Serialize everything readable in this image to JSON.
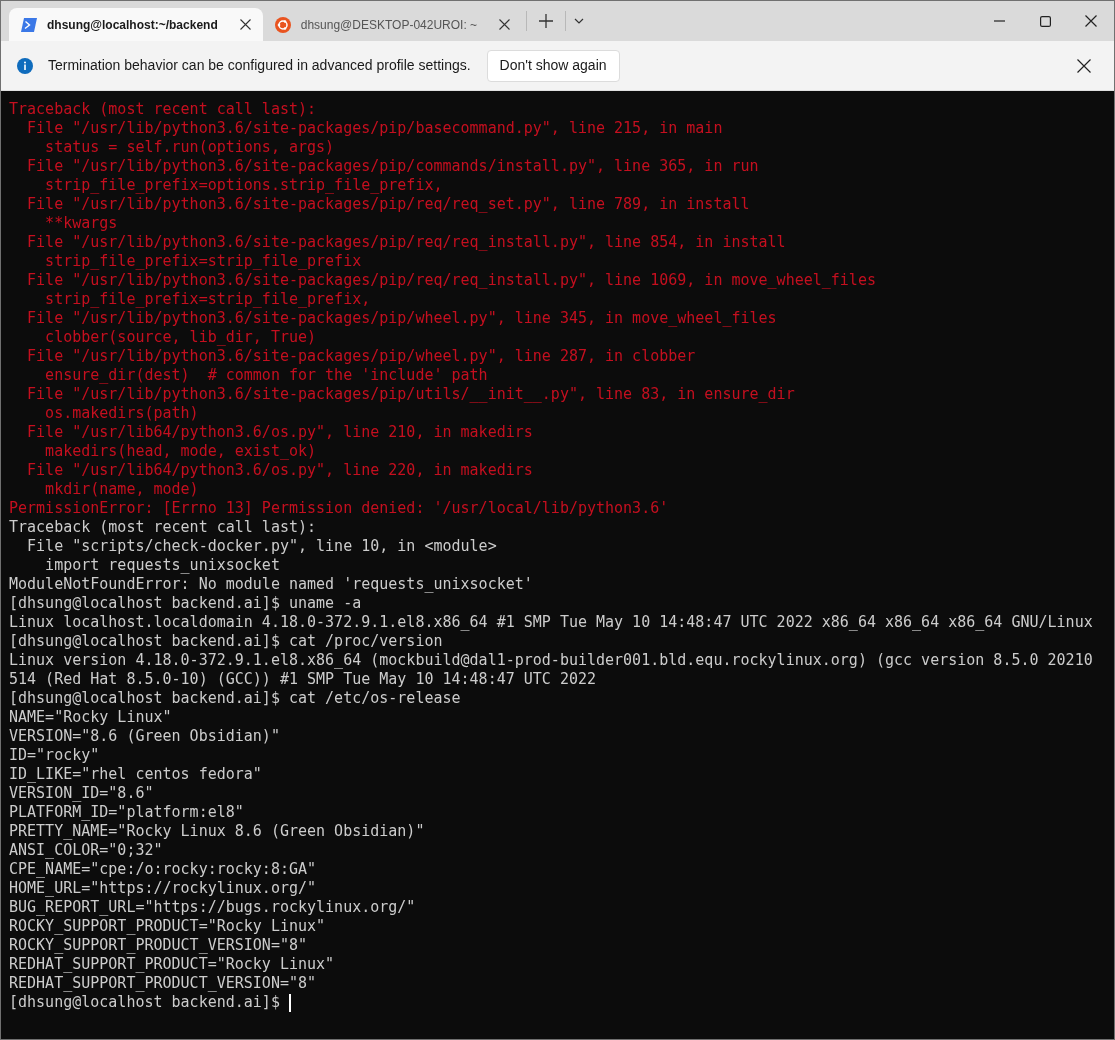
{
  "tabs": [
    {
      "title": "dhsung@localhost:~/backend",
      "kind": "shell",
      "selected": true
    },
    {
      "title": "dhsung@DESKTOP-042UROI: ~",
      "kind": "ubuntu",
      "selected": false
    }
  ],
  "infobar": {
    "message": "Termination behavior can be configured in advanced profile settings.",
    "button": "Don't show again"
  },
  "terminal": {
    "lines": [
      {
        "kind": "error",
        "text": "Traceback (most recent call last):"
      },
      {
        "kind": "error",
        "text": "  File \"/usr/lib/python3.6/site-packages/pip/basecommand.py\", line 215, in main"
      },
      {
        "kind": "error",
        "text": "    status = self.run(options, args)"
      },
      {
        "kind": "error",
        "text": "  File \"/usr/lib/python3.6/site-packages/pip/commands/install.py\", line 365, in run"
      },
      {
        "kind": "error",
        "text": "    strip_file_prefix=options.strip_file_prefix,"
      },
      {
        "kind": "error",
        "text": "  File \"/usr/lib/python3.6/site-packages/pip/req/req_set.py\", line 789, in install"
      },
      {
        "kind": "error",
        "text": "    **kwargs"
      },
      {
        "kind": "error",
        "text": "  File \"/usr/lib/python3.6/site-packages/pip/req/req_install.py\", line 854, in install"
      },
      {
        "kind": "error",
        "text": "    strip_file_prefix=strip_file_prefix"
      },
      {
        "kind": "error",
        "text": "  File \"/usr/lib/python3.6/site-packages/pip/req/req_install.py\", line 1069, in move_wheel_files"
      },
      {
        "kind": "error",
        "text": "    strip_file_prefix=strip_file_prefix,"
      },
      {
        "kind": "error",
        "text": "  File \"/usr/lib/python3.6/site-packages/pip/wheel.py\", line 345, in move_wheel_files"
      },
      {
        "kind": "error",
        "text": "    clobber(source, lib_dir, True)"
      },
      {
        "kind": "error",
        "text": "  File \"/usr/lib/python3.6/site-packages/pip/wheel.py\", line 287, in clobber"
      },
      {
        "kind": "error",
        "text": "    ensure_dir(dest)  # common for the 'include' path"
      },
      {
        "kind": "error",
        "text": "  File \"/usr/lib/python3.6/site-packages/pip/utils/__init__.py\", line 83, in ensure_dir"
      },
      {
        "kind": "error",
        "text": "    os.makedirs(path)"
      },
      {
        "kind": "error",
        "text": "  File \"/usr/lib64/python3.6/os.py\", line 210, in makedirs"
      },
      {
        "kind": "error",
        "text": "    makedirs(head, mode, exist_ok)"
      },
      {
        "kind": "error",
        "text": "  File \"/usr/lib64/python3.6/os.py\", line 220, in makedirs"
      },
      {
        "kind": "error",
        "text": "    mkdir(name, mode)"
      },
      {
        "kind": "error",
        "text": "PermissionError: [Errno 13] Permission denied: '/usr/local/lib/python3.6'"
      },
      {
        "kind": "output",
        "text": "Traceback (most recent call last):"
      },
      {
        "kind": "output",
        "text": "  File \"scripts/check-docker.py\", line 10, in <module>"
      },
      {
        "kind": "output",
        "text": "    import requests_unixsocket"
      },
      {
        "kind": "output",
        "text": "ModuleNotFoundError: No module named 'requests_unixsocket'"
      },
      {
        "kind": "output",
        "text": "[dhsung@localhost backend.ai]$ uname -a"
      },
      {
        "kind": "output",
        "text": "Linux localhost.localdomain 4.18.0-372.9.1.el8.x86_64 #1 SMP Tue May 10 14:48:47 UTC 2022 x86_64 x86_64 x86_64 GNU/Linux"
      },
      {
        "kind": "output",
        "text": "[dhsung@localhost backend.ai]$ cat /proc/version"
      },
      {
        "kind": "output",
        "text": "Linux version 4.18.0-372.9.1.el8.x86_64 (mockbuild@dal1-prod-builder001.bld.equ.rockylinux.org) (gcc version 8.5.0 20210"
      },
      {
        "kind": "output",
        "text": "514 (Red Hat 8.5.0-10) (GCC)) #1 SMP Tue May 10 14:48:47 UTC 2022"
      },
      {
        "kind": "output",
        "text": "[dhsung@localhost backend.ai]$ cat /etc/os-release"
      },
      {
        "kind": "output",
        "text": "NAME=\"Rocky Linux\""
      },
      {
        "kind": "output",
        "text": "VERSION=\"8.6 (Green Obsidian)\""
      },
      {
        "kind": "output",
        "text": "ID=\"rocky\""
      },
      {
        "kind": "output",
        "text": "ID_LIKE=\"rhel centos fedora\""
      },
      {
        "kind": "output",
        "text": "VERSION_ID=\"8.6\""
      },
      {
        "kind": "output",
        "text": "PLATFORM_ID=\"platform:el8\""
      },
      {
        "kind": "output",
        "text": "PRETTY_NAME=\"Rocky Linux 8.6 (Green Obsidian)\""
      },
      {
        "kind": "output",
        "text": "ANSI_COLOR=\"0;32\""
      },
      {
        "kind": "output",
        "text": "CPE_NAME=\"cpe:/o:rocky:rocky:8:GA\""
      },
      {
        "kind": "output",
        "text": "HOME_URL=\"https://rockylinux.org/\""
      },
      {
        "kind": "output",
        "text": "BUG_REPORT_URL=\"https://bugs.rockylinux.org/\""
      },
      {
        "kind": "output",
        "text": "ROCKY_SUPPORT_PRODUCT=\"Rocky Linux\""
      },
      {
        "kind": "output",
        "text": "ROCKY_SUPPORT_PRODUCT_VERSION=\"8\""
      },
      {
        "kind": "output",
        "text": "REDHAT_SUPPORT_PRODUCT=\"Rocky Linux\""
      },
      {
        "kind": "output",
        "text": "REDHAT_SUPPORT_PRODUCT_VERSION=\"8\""
      }
    ],
    "prompt": "[dhsung@localhost backend.ai]$ "
  }
}
